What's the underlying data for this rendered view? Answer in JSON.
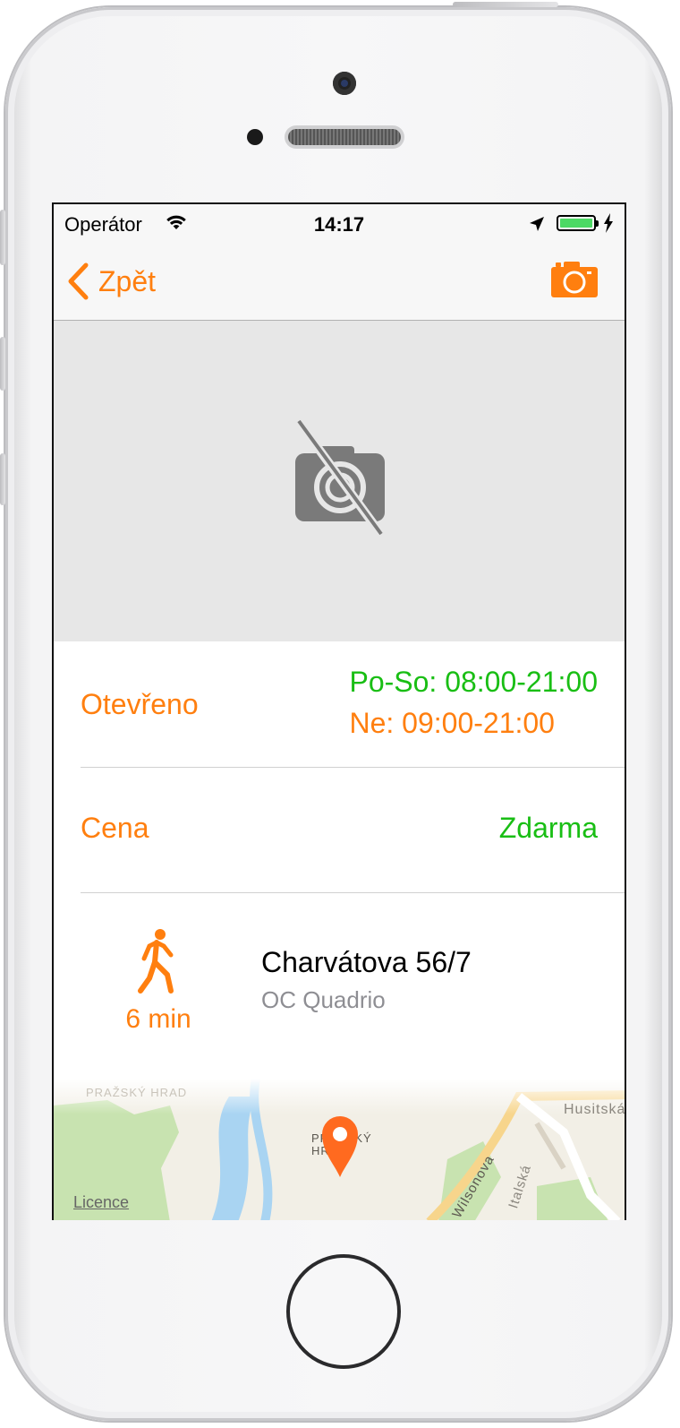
{
  "status_bar": {
    "carrier": "Operátor",
    "time": "14:17",
    "battery_color": "#4cd964"
  },
  "nav": {
    "back_label": "Zpět",
    "back_icon": "chevron-left-icon",
    "action_icon": "camera-icon"
  },
  "photo": {
    "placeholder_icon": "no-photo-icon"
  },
  "details": {
    "hours_label": "Otevřeno",
    "hours_weekday": "Po-So: 08:00-21:00",
    "hours_sunday": "Ne: 09:00-21:00",
    "price_label": "Cena",
    "price_value": "Zdarma"
  },
  "location": {
    "walk_icon": "walking-person-icon",
    "walk_time": "6 min",
    "street": "Charvátova 56/7",
    "place": "OC Quadrio"
  },
  "map": {
    "labels": [
      "PRAŽSKÝ HRAD",
      "PRAŽSKÝ\nHRAD",
      "Wilsonova",
      "Italská",
      "Husitská"
    ],
    "licence_label": "Licence"
  },
  "colors": {
    "accent": "#ff7f0f",
    "open_green": "#19be14",
    "muted_text": "#8e8e93"
  }
}
